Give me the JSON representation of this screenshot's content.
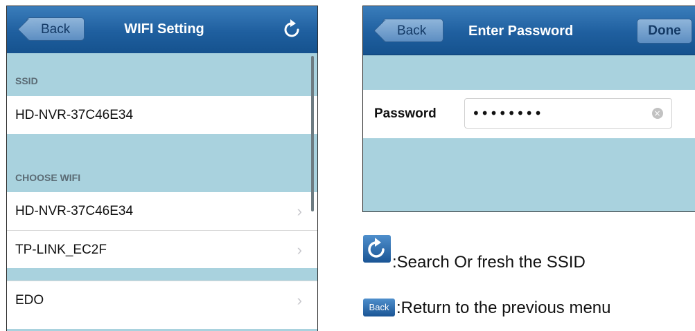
{
  "left_screen": {
    "back_label": "Back",
    "title": "WIFI Setting",
    "ssid_header": "SSID",
    "ssid_value": "HD-NVR-37C46E34",
    "choose_header": "CHOOSE WIFI",
    "wifi_list": [
      {
        "name": "HD-NVR-37C46E34"
      },
      {
        "name": "TP-LINK_EC2F"
      },
      {
        "name": "EDO"
      }
    ],
    "chevron": "›"
  },
  "right_screen": {
    "back_label": "Back",
    "title": "Enter Password",
    "done_label": "Done",
    "password_label": "Password",
    "password_value": "••••••••"
  },
  "legend": {
    "refresh_text": ":Search Or fresh the SSID",
    "back_icon_label": "Back",
    "back_text": ":Return to the previous menu"
  },
  "colors": {
    "navbar": "#1f5f9f",
    "section_bg": "#a9d2de",
    "text": "#111111"
  }
}
